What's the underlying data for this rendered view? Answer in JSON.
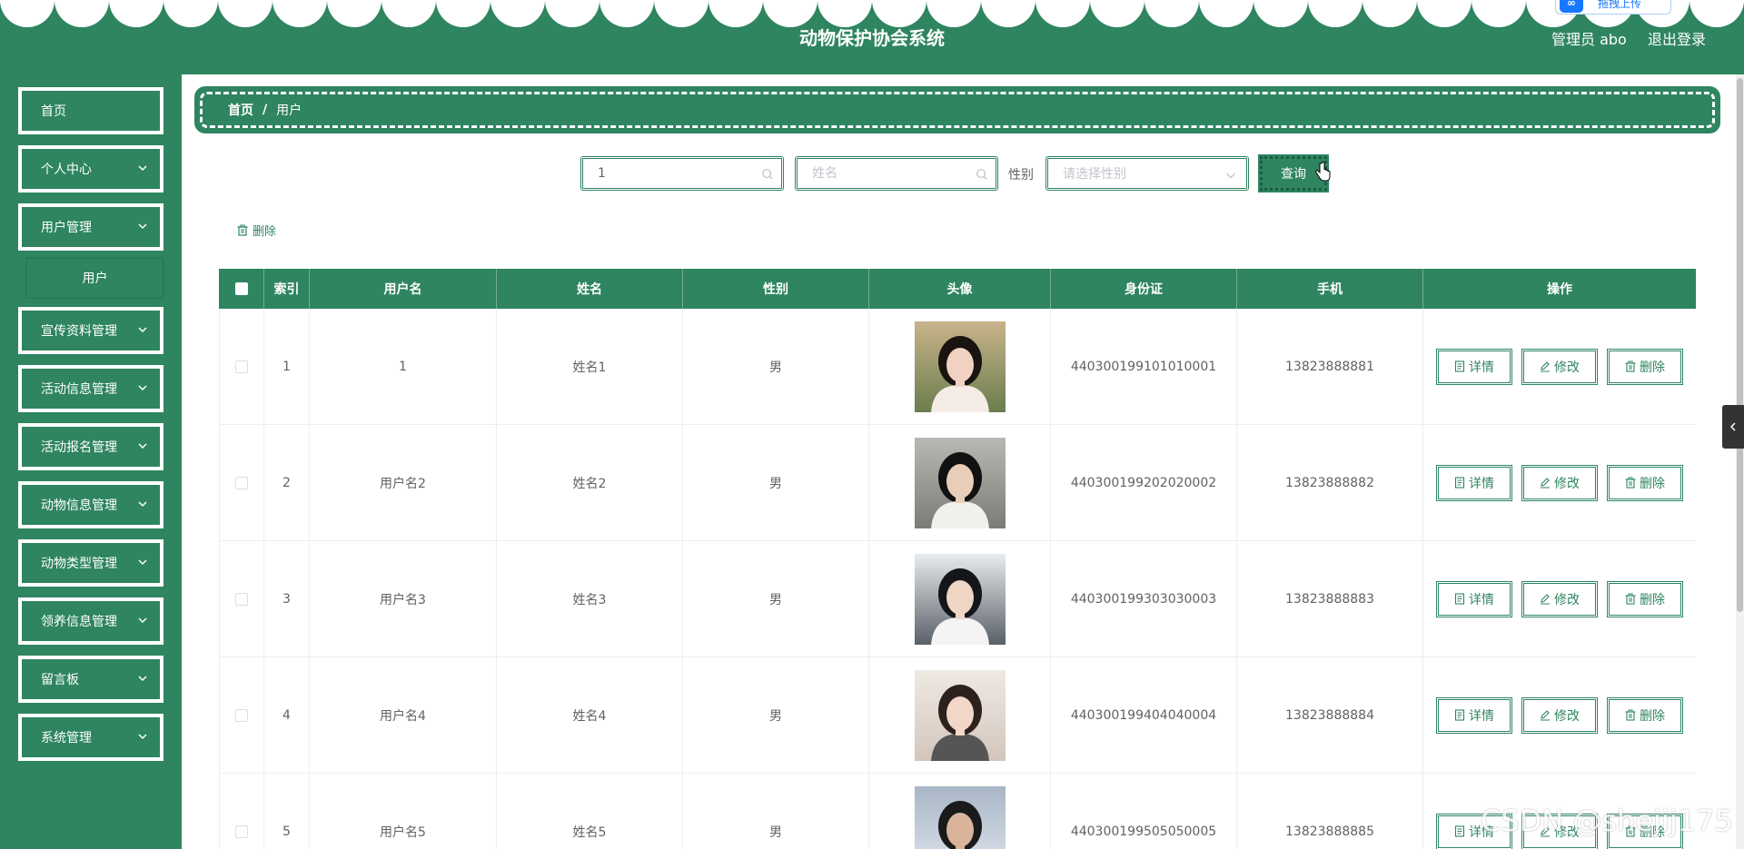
{
  "header": {
    "title": "动物保护协会系统",
    "admin": "管理员 abo",
    "logout": "退出登录",
    "upload_label": "拖拽上传",
    "bg_color": "#2e8560"
  },
  "sidebar": {
    "items": [
      {
        "label": "首页"
      },
      {
        "label": "个人中心"
      },
      {
        "label": "用户管理",
        "expanded": true
      },
      {
        "label": "宣传资料管理"
      },
      {
        "label": "活动信息管理"
      },
      {
        "label": "活动报名管理"
      },
      {
        "label": "动物信息管理"
      },
      {
        "label": "动物类型管理"
      },
      {
        "label": "领养信息管理"
      },
      {
        "label": "留言板"
      },
      {
        "label": "系统管理"
      }
    ],
    "sub_item": "用户"
  },
  "breadcrumb": {
    "home": "首页",
    "separator": "/",
    "current": "用户"
  },
  "search": {
    "username_value": "1",
    "name_placeholder": "姓名",
    "gender_label": "性别",
    "gender_placeholder": "请选择性别",
    "query_label": "查询"
  },
  "toolbar": {
    "delete_label": "删除"
  },
  "table": {
    "headers": [
      "索引",
      "用户名",
      "姓名",
      "性别",
      "头像",
      "身份证",
      "手机",
      "操作"
    ],
    "rows": [
      {
        "index": "1",
        "username": "1",
        "name": "姓名1",
        "gender": "男",
        "id_card": "440300199101010001",
        "phone": "13823888881"
      },
      {
        "index": "2",
        "username": "用户名2",
        "name": "姓名2",
        "gender": "男",
        "id_card": "440300199202020002",
        "phone": "13823888882"
      },
      {
        "index": "3",
        "username": "用户名3",
        "name": "姓名3",
        "gender": "男",
        "id_card": "440300199303030003",
        "phone": "13823888883"
      },
      {
        "index": "4",
        "username": "用户名4",
        "name": "姓名4",
        "gender": "男",
        "id_card": "440300199404040004",
        "phone": "13823888884"
      },
      {
        "index": "5",
        "username": "用户名5",
        "name": "姓名5",
        "gender": "男",
        "id_card": "440300199505050005",
        "phone": "13823888885"
      }
    ],
    "actions": {
      "detail": "详情",
      "edit": "修改",
      "delete": "删除"
    }
  },
  "watermark": "CSDN @shejij175"
}
